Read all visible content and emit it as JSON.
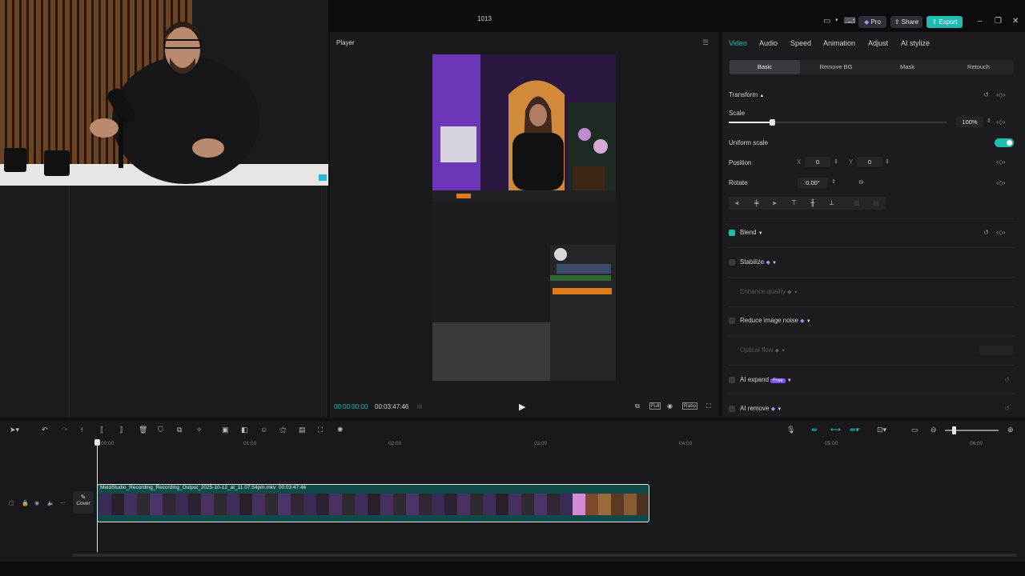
{
  "title_bar": {
    "project_name": "1013",
    "pro_label": "Pro",
    "share_label": "Share",
    "export_label": "Export"
  },
  "player": {
    "title": "Player",
    "current_time": "00:00:00:00",
    "total_time": "00:03:47:46",
    "full_label": "Full",
    "ratio_label": "Ratio"
  },
  "inspector": {
    "tabs": [
      "Video",
      "Audio",
      "Speed",
      "Animation",
      "Adjust",
      "AI stylize"
    ],
    "active_tab": "Video",
    "subtabs": [
      "Basic",
      "Remove BG",
      "Mask",
      "Retouch"
    ],
    "active_subtab": "Basic",
    "transform_label": "Transform",
    "scale_label": "Scale",
    "scale_value": "100%",
    "scale_level": 0.2,
    "uniform_scale_label": "Uniform scale",
    "uniform_scale_on": true,
    "position_label": "Position",
    "pos_x_label": "X",
    "pos_x_value": "0",
    "pos_y_label": "Y",
    "pos_y_value": "0",
    "rotate_label": "Rotate",
    "rotate_value": "0.00°",
    "blend_label": "Blend",
    "stabilize_label": "Stabilize",
    "enhance_quality_label": "Enhance quality",
    "reduce_noise_label": "Reduce image noise",
    "optical_flow_label": "Optical flow",
    "ai_expand_label": "AI expand",
    "free_badge": "Free",
    "ai_remove_label": "AI remove"
  },
  "timeline": {
    "ruler": [
      "00:00",
      "01:00",
      "02:00",
      "03:00",
      "04:00",
      "05:00",
      "06:00"
    ],
    "clip_name": "MeldStudio_Recording_Recording_Output_2025-10-12_at_11.07.54pm.mkv",
    "clip_duration": "00:03:47:46",
    "cover_label": "Cover"
  },
  "colors": {
    "accent": "#1fbdb0",
    "background": "#1c1c1f",
    "clip": "#0f4a48"
  }
}
